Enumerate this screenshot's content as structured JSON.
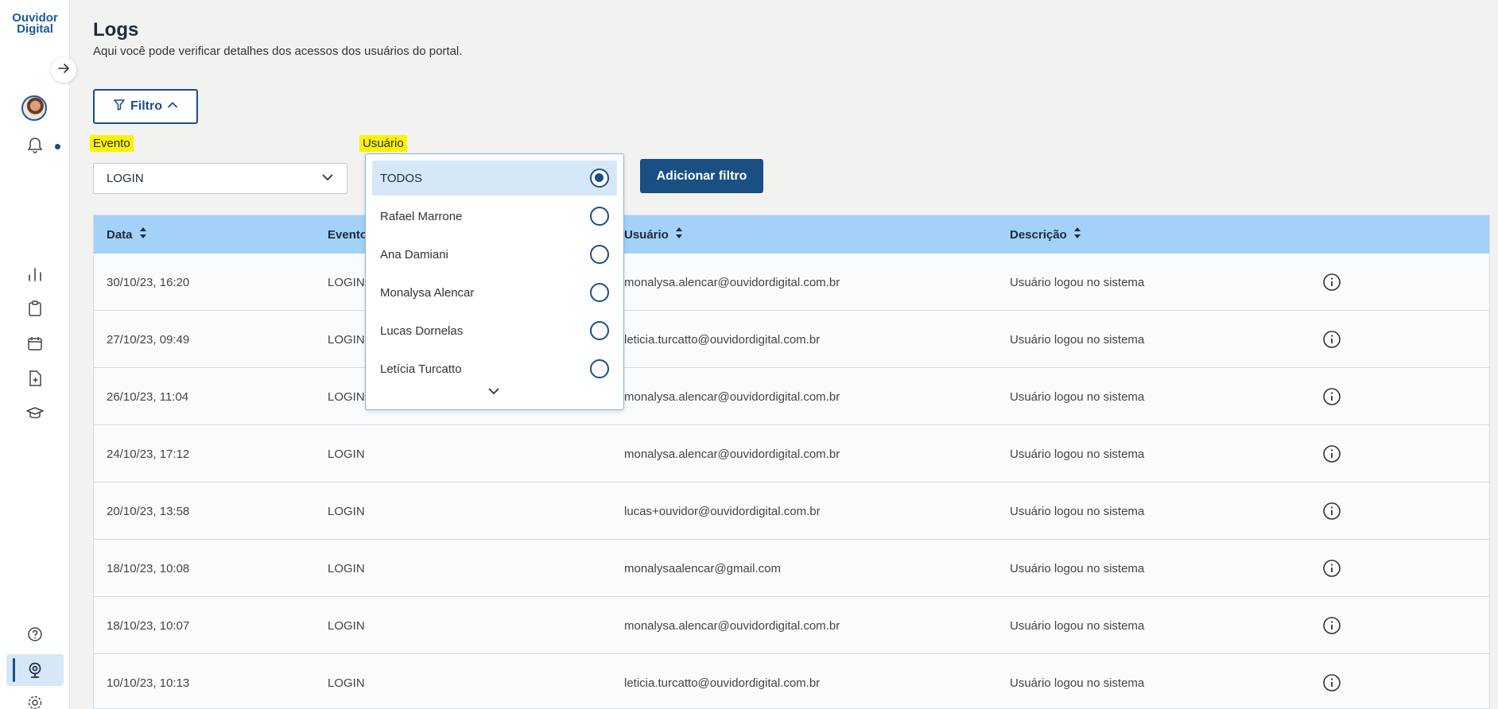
{
  "sidebar": {
    "logo_line1": "Ouvidor",
    "logo_line2": "Digital",
    "icons": [
      "arrow-right-icon",
      "avatar",
      "bell-icon",
      "bar-chart-icon",
      "clipboard-icon",
      "calendar-icon",
      "file-plus-icon",
      "graduation-cap-icon",
      "help-icon",
      "webcam-icon",
      "gear-icon"
    ]
  },
  "header": {
    "title": "Logs",
    "subtitle": "Aqui você pode verificar detalhes dos acessos dos usuários do portal."
  },
  "filter": {
    "toggle_label": "Filtro",
    "evento_label": "Evento",
    "evento_value": "LOGIN",
    "usuario_label": "Usuário",
    "add_button": "Adicionar filtro"
  },
  "dropdown": {
    "options": [
      {
        "label": "TODOS",
        "selected": true
      },
      {
        "label": "Rafael Marrone",
        "selected": false
      },
      {
        "label": "Ana Damiani",
        "selected": false
      },
      {
        "label": "Monalysa Alencar",
        "selected": false
      },
      {
        "label": "Lucas Dornelas",
        "selected": false
      },
      {
        "label": "Letícia Turcatto",
        "selected": false
      }
    ]
  },
  "table": {
    "headers": {
      "data": "Data",
      "evento": "Evento",
      "usuario": "Usuário",
      "descricao": "Descrição"
    },
    "rows": [
      {
        "data": "30/10/23, 16:20",
        "evento": "LOGIN",
        "usuario": "monalysa.alencar@ouvidordigital.com.br",
        "descricao": "Usuário logou no sistema"
      },
      {
        "data": "27/10/23, 09:49",
        "evento": "LOGIN",
        "usuario": "leticia.turcatto@ouvidordigital.com.br",
        "descricao": "Usuário logou no sistema"
      },
      {
        "data": "26/10/23, 11:04",
        "evento": "LOGIN",
        "usuario": "monalysa.alencar@ouvidordigital.com.br",
        "descricao": "Usuário logou no sistema"
      },
      {
        "data": "24/10/23, 17:12",
        "evento": "LOGIN",
        "usuario": "monalysa.alencar@ouvidordigital.com.br",
        "descricao": "Usuário logou no sistema"
      },
      {
        "data": "20/10/23, 13:58",
        "evento": "LOGIN",
        "usuario": "lucas+ouvidor@ouvidordigital.com.br",
        "descricao": "Usuário logou no sistema"
      },
      {
        "data": "18/10/23, 10:08",
        "evento": "LOGIN",
        "usuario": "monalysaalencar@gmail.com",
        "descricao": "Usuário logou no sistema"
      },
      {
        "data": "18/10/23, 10:07",
        "evento": "LOGIN",
        "usuario": "monalysa.alencar@ouvidordigital.com.br",
        "descricao": "Usuário logou no sistema"
      },
      {
        "data": "10/10/23, 10:13",
        "evento": "LOGIN",
        "usuario": "leticia.turcatto@ouvidordigital.com.br",
        "descricao": "Usuário logou no sistema"
      }
    ]
  },
  "colors": {
    "primary": "#1a4f84",
    "header_bg": "#a3d1f8",
    "selected_bg": "#d6e8f8",
    "highlight": "#fff200"
  }
}
